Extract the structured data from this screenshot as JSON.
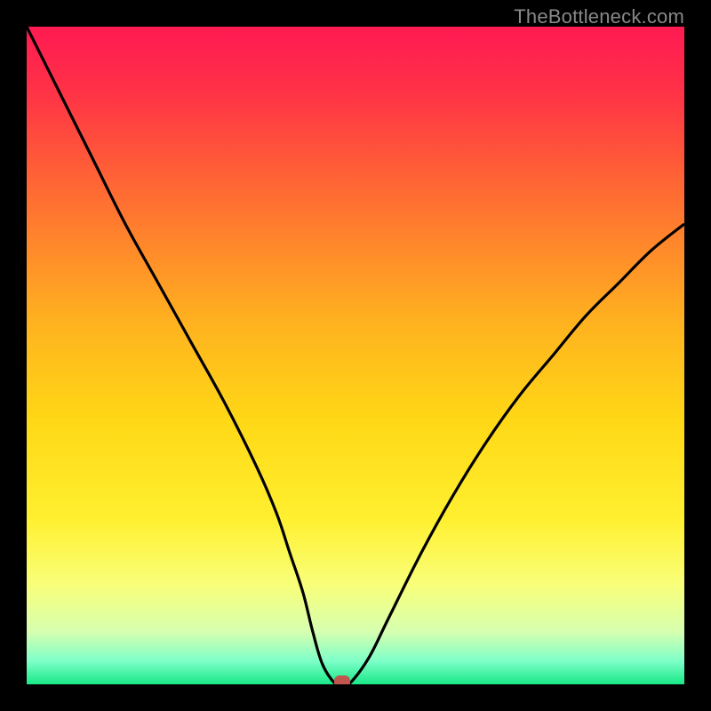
{
  "watermark": "TheBottleneck.com",
  "colors": {
    "frame": "#000000",
    "watermark_text": "#888888",
    "curve": "#000000",
    "marker": "#c0564d",
    "gradient_stops": [
      {
        "offset": 0.0,
        "color": "#ff1a52"
      },
      {
        "offset": 0.1,
        "color": "#ff3246"
      },
      {
        "offset": 0.25,
        "color": "#ff6a33"
      },
      {
        "offset": 0.45,
        "color": "#ffb21f"
      },
      {
        "offset": 0.6,
        "color": "#ffd816"
      },
      {
        "offset": 0.75,
        "color": "#fff030"
      },
      {
        "offset": 0.85,
        "color": "#f8ff7a"
      },
      {
        "offset": 0.92,
        "color": "#d6ffb0"
      },
      {
        "offset": 0.965,
        "color": "#7dffc8"
      },
      {
        "offset": 1.0,
        "color": "#18e887"
      }
    ]
  },
  "chart_data": {
    "type": "line",
    "title": "",
    "xlabel": "",
    "ylabel": "",
    "xlim": [
      0,
      100
    ],
    "ylim": [
      0,
      100
    ],
    "series": [
      {
        "name": "bottleneck-curve",
        "x": [
          0,
          5,
          10,
          15,
          20,
          25,
          30,
          35,
          38,
          40,
          42,
          43.5,
          45,
          47,
          48,
          49,
          52,
          55,
          60,
          65,
          70,
          75,
          80,
          85,
          90,
          95,
          100
        ],
        "values": [
          100,
          90,
          80,
          70,
          61,
          52,
          43,
          33,
          26,
          20,
          14,
          8,
          3,
          0,
          0,
          0,
          4,
          10,
          20,
          29,
          37,
          44,
          50,
          56,
          61,
          66,
          70
        ]
      }
    ],
    "annotations": [
      {
        "name": "minimum-marker",
        "x": 48,
        "y": 0
      }
    ]
  }
}
